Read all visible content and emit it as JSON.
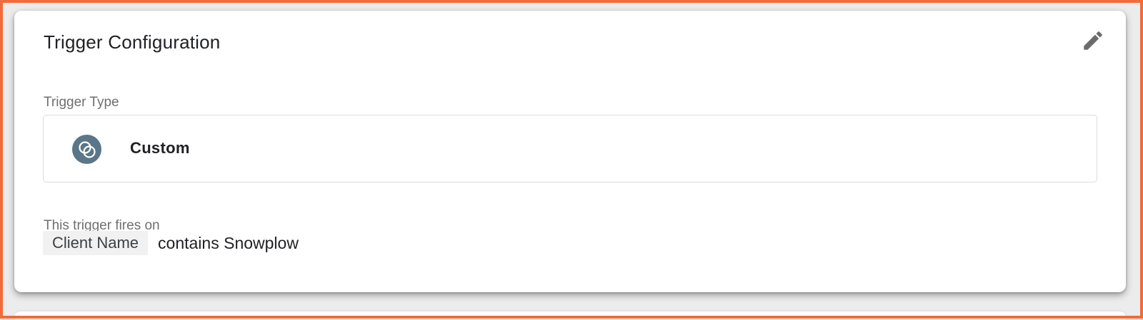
{
  "card": {
    "title": "Trigger Configuration",
    "edit_icon": "pencil-icon"
  },
  "trigger_type": {
    "label": "Trigger Type",
    "name": "Custom",
    "icon": "custom-trigger-icon",
    "icon_color": "#5a7688"
  },
  "firing": {
    "label": "This trigger fires on",
    "variable": "Client Name",
    "condition": "contains Snowplow"
  },
  "colors": {
    "frame_border": "#f26b3a"
  }
}
